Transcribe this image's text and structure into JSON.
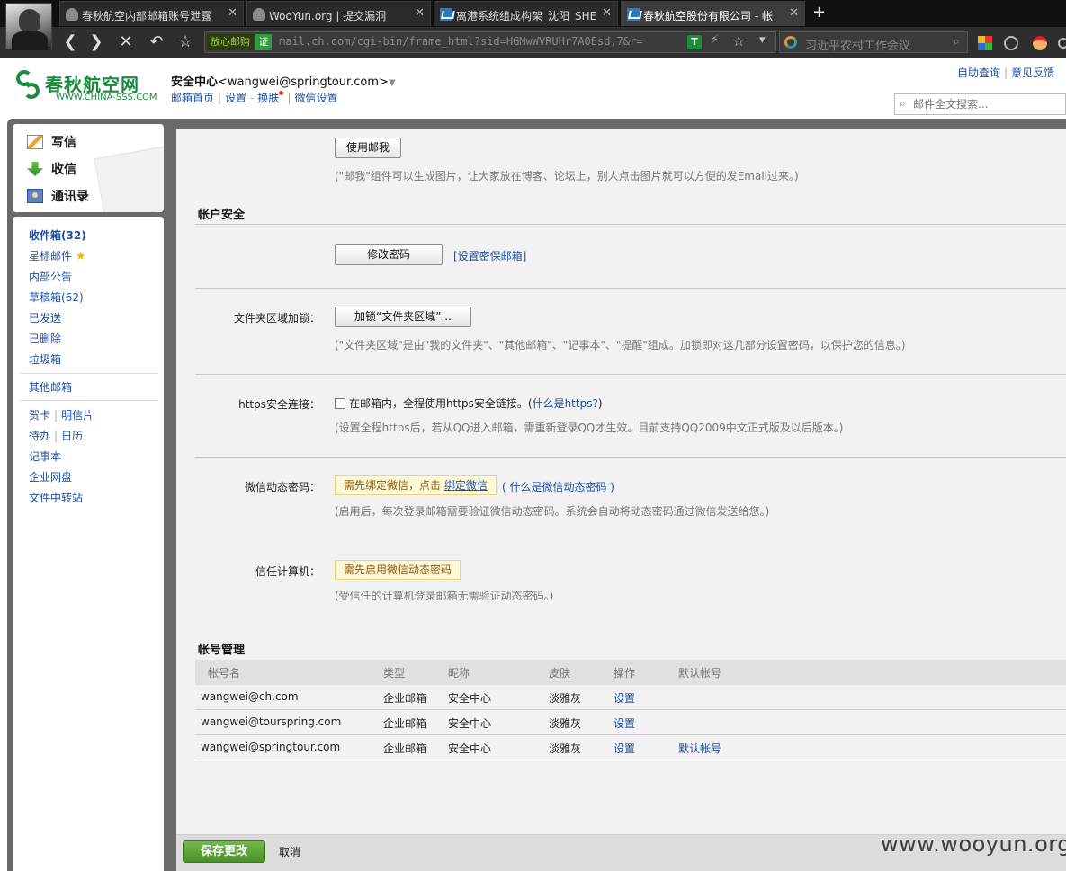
{
  "browser": {
    "tabs": [
      {
        "title": "春秋航空内部邮箱账号泄露",
        "icon": "cloud-icon"
      },
      {
        "title": "WooYun.org | 提交漏洞",
        "icon": "cloud-icon"
      },
      {
        "title": "离港系统组成构架_沈阳_SHE",
        "icon": "mail-icon"
      },
      {
        "title": "春秋航空股份有限公司 - 帐",
        "icon": "mail-icon"
      }
    ],
    "new_tab": "+",
    "url_secure_label": "放心邮购",
    "url_cert": "证",
    "url": "mail.ch.com/cgi-bin/frame_html?sid=HGMwWVRUHr7A0Esd,7&r=",
    "search_placeholder": "习近平农村工作会议",
    "nav": {
      "back": "❮",
      "forward": "❯",
      "stop": "✕",
      "undo": "↶",
      "bookmark": "☆"
    }
  },
  "header": {
    "logo_cn": "春秋航空网",
    "logo_en": "WWW.CHINA-SSS.COM",
    "account_name": "安全中心",
    "account_email": "<wangwei@springtour.com>",
    "nav": [
      "邮箱首页",
      "设置",
      "换肤",
      "微信设置"
    ],
    "top_links": [
      "自助查询",
      "意见反馈"
    ],
    "search_placeholder": "邮件全文搜索..."
  },
  "compose": [
    "写信",
    "收信",
    "通讯录"
  ],
  "folders": {
    "inbox_label": "收件箱",
    "inbox_count": "(32)",
    "starred": "星标邮件",
    "notice": "内部公告",
    "drafts_label": "草稿箱",
    "drafts_count": "(62)",
    "sent": "已发送",
    "deleted": "已删除",
    "trash": "垃圾箱",
    "other": "其他邮箱",
    "cards": "贺卡",
    "postcards": "明信片",
    "todo": "待办",
    "calendar": "日历",
    "notes": "记事本",
    "disk": "企业网盘",
    "transfer": "文件中转站"
  },
  "settings": {
    "mail_me_button": "使用邮我",
    "mail_me_hint": "(\"邮我\"组件可以生成图片，让大家放在博客、论坛上，别人点击图片就可以方便的发Email过来。)",
    "account_security_title": "帐户安全",
    "change_password_button": "修改密码",
    "set_security_mailbox": "[设置密保邮箱]",
    "folder_lock_label": "文件夹区域加锁：",
    "folder_lock_button": "加锁“文件夹区域”...",
    "folder_lock_hint": "(\"文件夹区域\"是由\"我的文件夹\"、\"其他邮箱\"、\"记事本\"、\"提醒\"组成。加锁即对这几部分设置密码，以保护您的信息。)",
    "https_label": "https安全连接：",
    "https_checkbox_label": "在邮箱内，全程使用https安全链接。",
    "https_what_prefix": "(",
    "https_what_link": "什么是https?",
    "https_what_suffix": ")",
    "https_hint": "(设置全程https后，若从QQ进入邮箱，需重新登录QQ才生效。目前支持QQ2009中文正式版及以后版本。)",
    "https_checked": false,
    "wechat_otp_label": "微信动态密码：",
    "wechat_otp_warn": "需先绑定微信，点击",
    "wechat_otp_bind": "绑定微信",
    "wechat_otp_what": "( 什么是微信动态密码 )",
    "wechat_otp_hint": "(启用后，每次登录邮箱需要验证微信动态密码。系统会自动将动态密码通过微信发送给您。)",
    "trusted_pc_label": "信任计算机：",
    "trusted_pc_warn": "需先启用微信动态密码",
    "trusted_pc_hint": "(受信任的计算机登录邮箱无需验证动态密码。)",
    "account_mgmt_title": "帐号管理"
  },
  "accounts_table": {
    "headers": [
      "帐号名",
      "类型",
      "昵称",
      "皮肤",
      "操作",
      "默认帐号"
    ],
    "rows": [
      {
        "name": "wangwei@ch.com",
        "type": "企业邮箱",
        "nick": "安全中心",
        "skin": "淡雅灰",
        "op": "设置",
        "default": ""
      },
      {
        "name": "wangwei@tourspring.com",
        "type": "企业邮箱",
        "nick": "安全中心",
        "skin": "淡雅灰",
        "op": "设置",
        "default": ""
      },
      {
        "name": "wangwei@springtour.com",
        "type": "企业邮箱",
        "nick": "安全中心",
        "skin": "淡雅灰",
        "op": "设置",
        "default": "默认帐号"
      }
    ]
  },
  "footer": {
    "save": "保存更改",
    "cancel": "取消"
  },
  "watermark": "www.wooyun.org",
  "colors": {
    "brand_green": "#1a8a3f",
    "link_blue": "#1e50a2",
    "save_green": "#4a8f2a",
    "warn_bg": "#fff8d6"
  }
}
